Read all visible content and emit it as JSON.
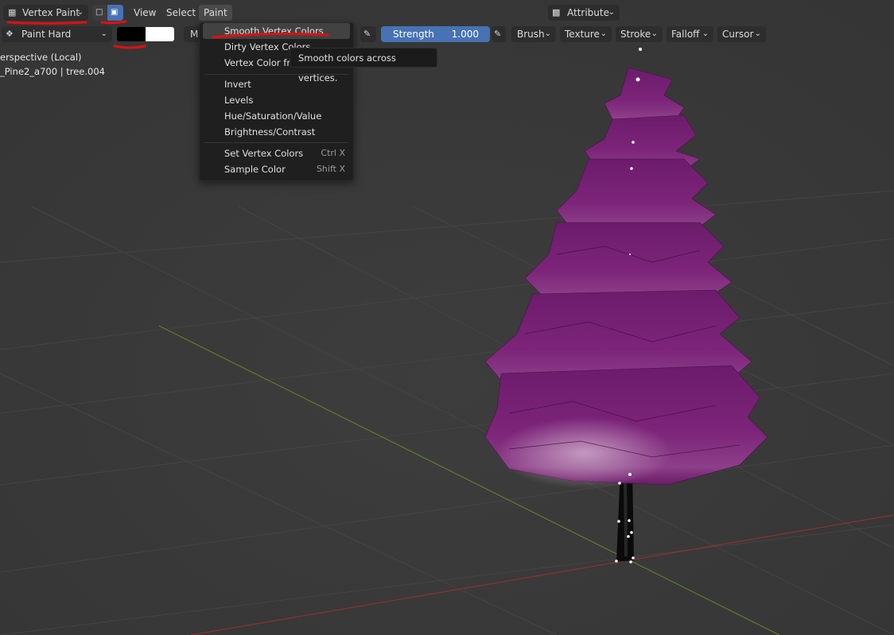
{
  "header": {
    "mode_label": "Vertex Paint",
    "menus": [
      "View",
      "Select",
      "Paint"
    ],
    "attribute_label": "Attribute"
  },
  "tool_settings": {
    "brush_name": "Paint Hard",
    "color_primary": "#000000",
    "color_secondary": "#ffffff",
    "blend_abbrev": "M",
    "strength_label": "Strength",
    "strength_value": "1.000",
    "dropdowns": [
      "Brush",
      "Texture",
      "Stroke",
      "Falloff",
      "Cursor"
    ]
  },
  "viewport": {
    "view_name": "erspective (Local)",
    "object_path": "_Pine2_a700 | tree.004"
  },
  "paint_menu": {
    "items": [
      {
        "label": "Smooth Vertex Colors",
        "shortcut": ""
      },
      {
        "label": "Dirty Vertex Colors",
        "shortcut": ""
      },
      {
        "label": "Vertex Color fro",
        "shortcut": ""
      },
      {
        "label": "Invert",
        "shortcut": ""
      },
      {
        "label": "Levels",
        "shortcut": ""
      },
      {
        "label": "Hue/Saturation/Value",
        "shortcut": ""
      },
      {
        "label": "Brightness/Contrast",
        "shortcut": ""
      },
      {
        "label": "Set Vertex Colors",
        "shortcut": "Ctrl X"
      },
      {
        "label": "Sample Color",
        "shortcut": "Shift X"
      }
    ],
    "tooltip": "Smooth colors across vertices."
  },
  "colors": {
    "annotation": "#e01010",
    "accent": "#4772b3",
    "tree": "#7a1f78"
  }
}
